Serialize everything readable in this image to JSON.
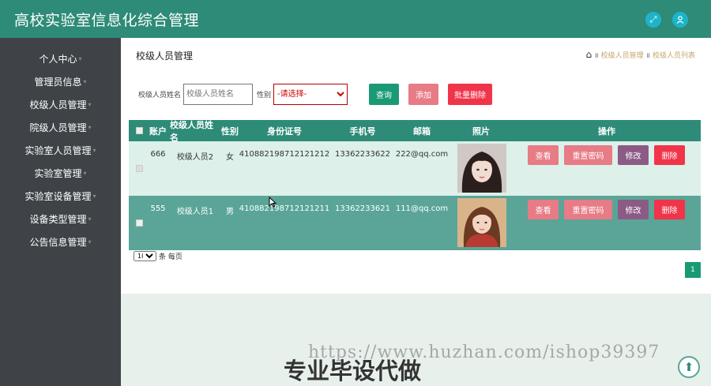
{
  "header": {
    "title": "高校实验室信息化综合管理",
    "icons": [
      "fullscreen-icon",
      "user-icon"
    ]
  },
  "sidebar": {
    "items": [
      {
        "label": "个人中心"
      },
      {
        "label": "管理员信息"
      },
      {
        "label": "校级人员管理"
      },
      {
        "label": "院级人员管理"
      },
      {
        "label": "实验室人员管理"
      },
      {
        "label": "实验室管理"
      },
      {
        "label": "实验室设备管理"
      },
      {
        "label": "设备类型管理"
      },
      {
        "label": "公告信息管理"
      }
    ]
  },
  "page": {
    "title": "校级人员管理",
    "breadcrumb": [
      "校级人员管理",
      "校级人员列表"
    ]
  },
  "search": {
    "name_label": "校级人员姓名",
    "name_placeholder": "校级人员姓名",
    "gender_label": "性别",
    "gender_selected": "-请选择-",
    "query_button": "查询",
    "add_button": "添加",
    "batch_delete_button": "批量删除"
  },
  "table": {
    "headers": [
      "账户",
      "校级人员姓名",
      "性别",
      "身份证号",
      "手机号",
      "邮箱",
      "照片",
      "操作"
    ],
    "rows": [
      {
        "account": "666",
        "name": "校级人员2",
        "gender": "女",
        "id_number": "410882198712121212",
        "phone": "13362233622",
        "email": "222@qq.com"
      },
      {
        "account": "555",
        "name": "校级人员1",
        "gender": "男",
        "id_number": "410882198712121211",
        "phone": "13362233621",
        "email": "111@qq.com"
      }
    ],
    "ops": {
      "view": "查看",
      "reset": "重置密码",
      "edit": "修改",
      "delete": "删除"
    }
  },
  "pagination": {
    "page_size": "10",
    "per_page_label": "条 每页",
    "current_page": "1"
  },
  "watermark": {
    "url": "https://www.huzhan.com/ishop39397",
    "text": "专业毕设代做"
  },
  "colors": {
    "header": "#2e8b78",
    "sidebar": "#3f4348",
    "accent": "#1a9a74",
    "danger": "#f0344a",
    "pink": "#e77b86"
  }
}
